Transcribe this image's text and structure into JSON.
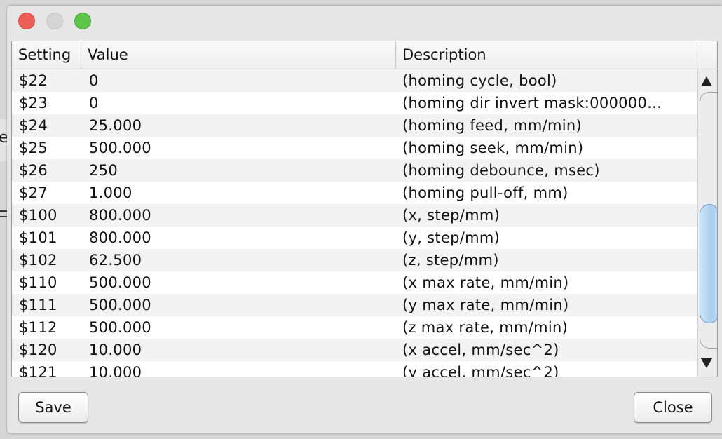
{
  "background": {
    "partial_letter": "e"
  },
  "table": {
    "columns": [
      "Setting",
      "Value",
      "Description"
    ],
    "rows": [
      {
        "setting": "$22",
        "value": "0",
        "description": "(homing cycle, bool)"
      },
      {
        "setting": "$23",
        "value": "0",
        "description": "(homing dir invert mask:000000..."
      },
      {
        "setting": "$24",
        "value": "25.000",
        "description": "(homing feed, mm/min)"
      },
      {
        "setting": "$25",
        "value": "500.000",
        "description": "(homing seek, mm/min)"
      },
      {
        "setting": "$26",
        "value": "250",
        "description": "(homing debounce, msec)"
      },
      {
        "setting": "$27",
        "value": "1.000",
        "description": "(homing pull-off, mm)"
      },
      {
        "setting": "$100",
        "value": "800.000",
        "description": "(x, step/mm)"
      },
      {
        "setting": "$101",
        "value": "800.000",
        "description": "(y, step/mm)"
      },
      {
        "setting": "$102",
        "value": "62.500",
        "description": "(z, step/mm)"
      },
      {
        "setting": "$110",
        "value": "500.000",
        "description": "(x max rate, mm/min)"
      },
      {
        "setting": "$111",
        "value": "500.000",
        "description": "(y max rate, mm/min)"
      },
      {
        "setting": "$112",
        "value": "500.000",
        "description": "(z max rate, mm/min)"
      },
      {
        "setting": "$120",
        "value": "10.000",
        "description": "(x accel, mm/sec^2)"
      },
      {
        "setting": "$121",
        "value": "10.000",
        "description": "(y accel, mm/sec^2)"
      }
    ]
  },
  "buttons": {
    "save": "Save",
    "close": "Close"
  },
  "colors": {
    "close_light": "#ec5f57",
    "minimize_light": "#d5d5d5",
    "maximize_light": "#5cc54a",
    "scroll_thumb": "#a9cdee"
  },
  "icons": [
    "close-icon",
    "minimize-icon",
    "maximize-icon",
    "scroll-up-icon",
    "scroll-down-icon"
  ]
}
